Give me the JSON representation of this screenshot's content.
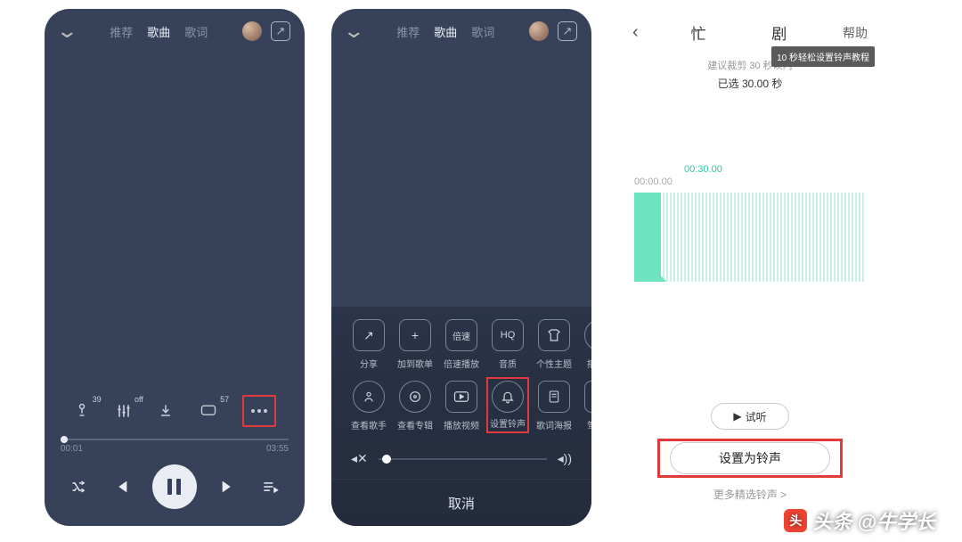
{
  "panel1": {
    "tabs": [
      "推荐",
      "歌曲",
      "歌词"
    ],
    "active_tab_index": 1,
    "mid_icons": {
      "mic_sup": "39",
      "eq_sup": "off",
      "msg_sup": "57"
    },
    "progress": {
      "current": "00:01",
      "total": "03:55"
    }
  },
  "panel2": {
    "tabs": [
      "推荐",
      "歌曲",
      "歌词"
    ],
    "active_tab_index": 1,
    "row1": [
      {
        "label": "分享",
        "icon": "↗"
      },
      {
        "label": "加到歌单",
        "icon": "+"
      },
      {
        "label": "倍速播放",
        "icon": "倍速"
      },
      {
        "label": "音质",
        "icon": "HQ"
      },
      {
        "label": "个性主题",
        "icon": "tshirt"
      },
      {
        "label": "播放器",
        "icon": "▷"
      }
    ],
    "row2": [
      {
        "label": "查看歌手",
        "icon": "person"
      },
      {
        "label": "查看专辑",
        "icon": "disc"
      },
      {
        "label": "播放视频",
        "icon": "video"
      },
      {
        "label": "设置铃声",
        "icon": "bell"
      },
      {
        "label": "歌词海报",
        "icon": "poster"
      },
      {
        "label": "驾驶模",
        "icon": "car"
      }
    ],
    "cancel": "取消"
  },
  "panel3": {
    "title_left": "忙",
    "title_right": "剧",
    "help": "帮助",
    "tip": "10 秒轻松设置铃声教程",
    "suggest": "建议裁剪 30 秒以内",
    "selected": "已选 30.00 秒",
    "time_start": "00:00.00",
    "time_end": "00:30.00",
    "preview": "试听",
    "set_ringtone": "设置为铃声",
    "more": "更多精选铃声 >"
  },
  "watermark": "头条 @牛学长"
}
